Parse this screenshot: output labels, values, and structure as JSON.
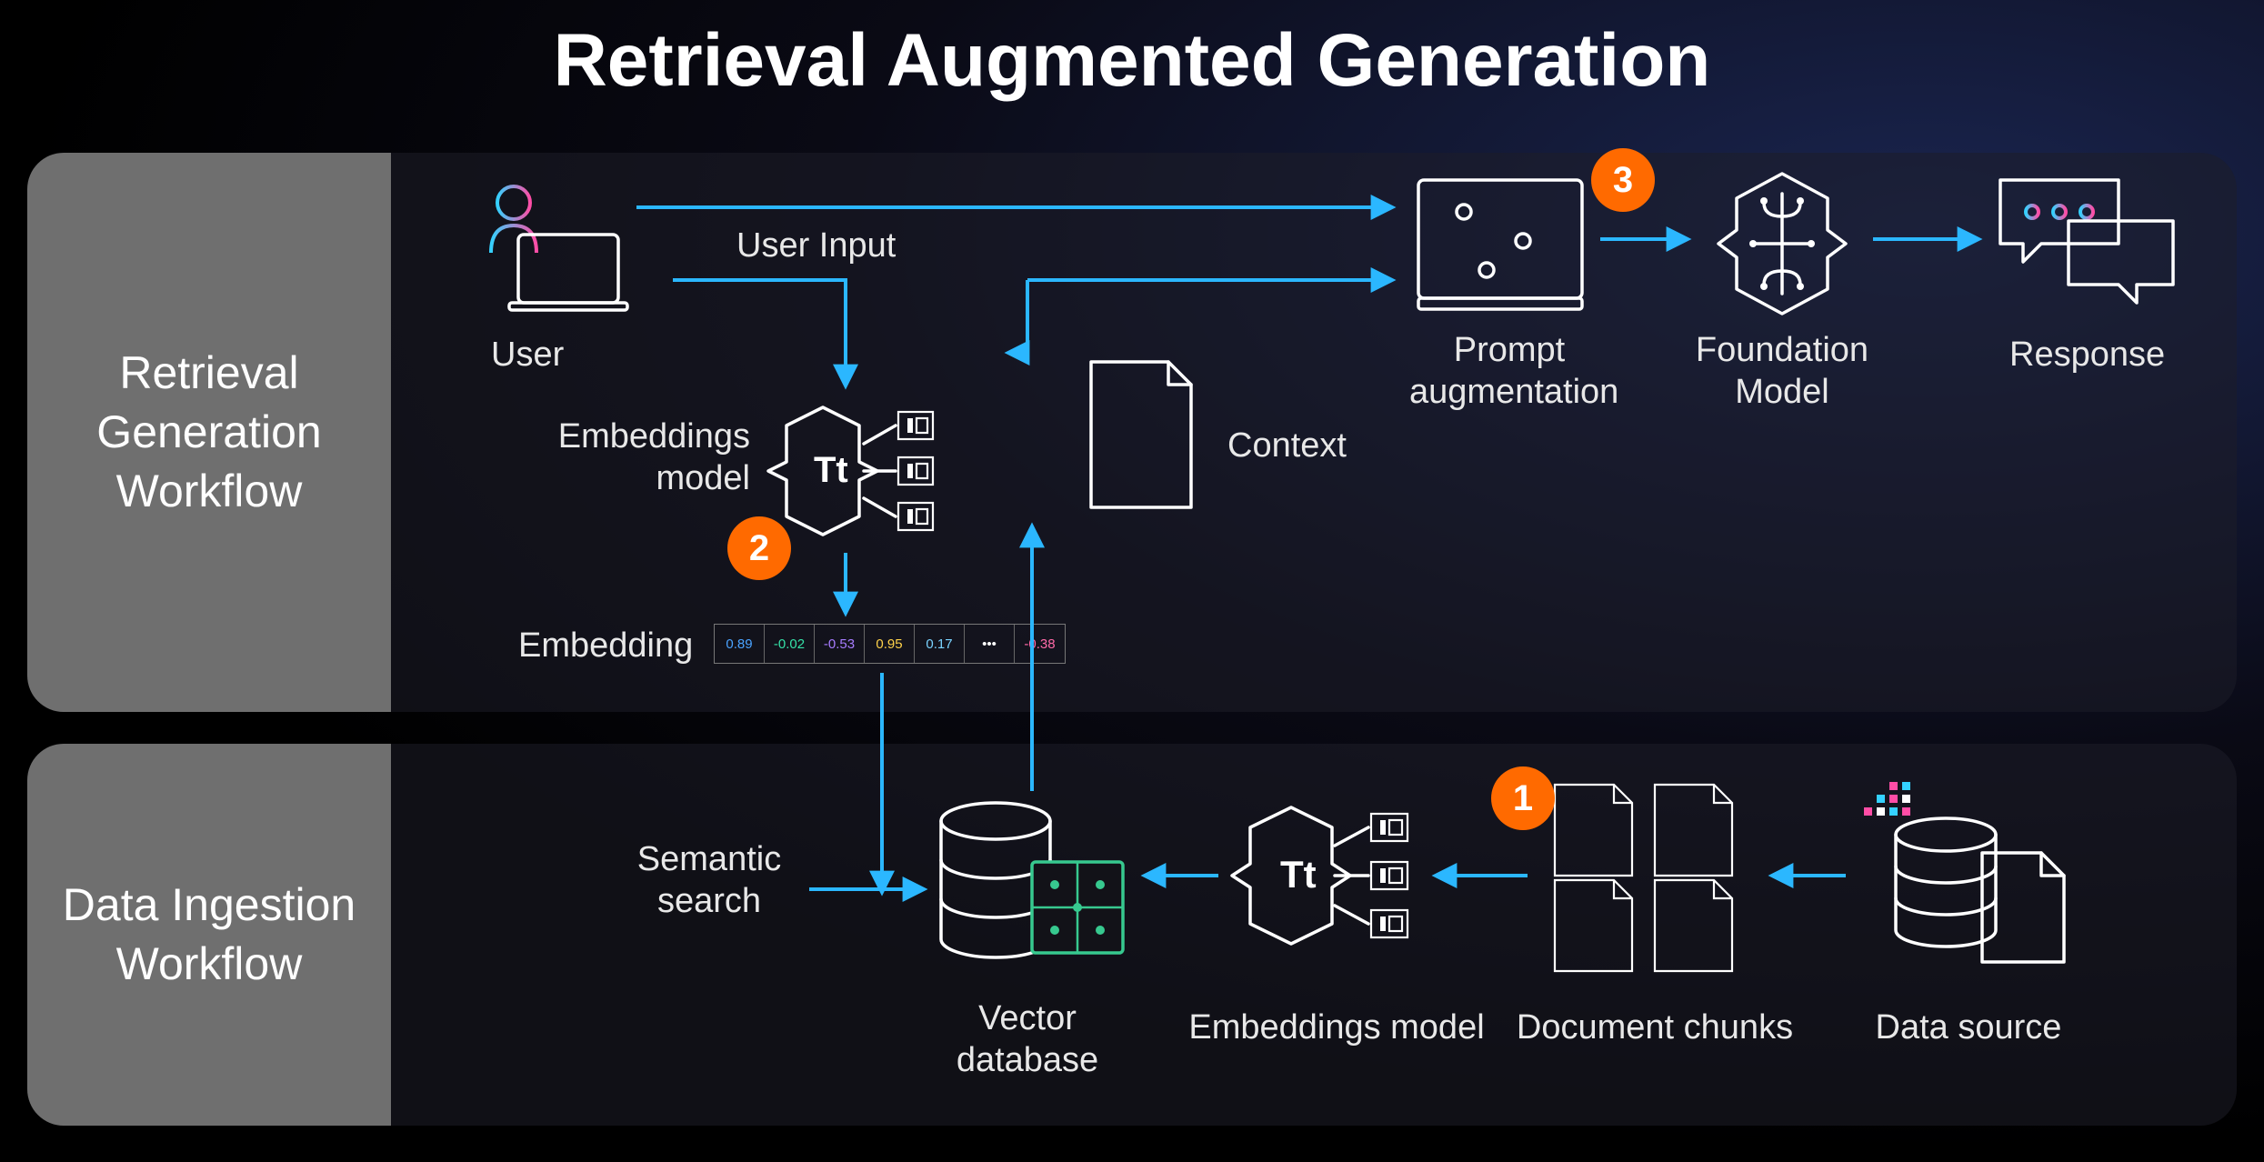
{
  "title": "Retrieval Augmented Generation",
  "panels": {
    "top": {
      "label": "Retrieval\nGeneration\nWorkflow"
    },
    "bottom": {
      "label": "Data Ingestion\nWorkflow"
    }
  },
  "nodes": {
    "user": "User",
    "user_input": "User Input",
    "embeddings_model_top": "Embeddings\nmodel",
    "embedding": "Embedding",
    "context": "Context",
    "prompt_aug": "Prompt\naugmentation",
    "foundation_model": "Foundation\nModel",
    "response": "Response",
    "semantic_search": "Semantic\nsearch",
    "vector_db": "Vector\ndatabase",
    "embeddings_model_bot": "Embeddings model",
    "doc_chunks": "Document chunks",
    "data_source": "Data source"
  },
  "embedding_vector": [
    "0.89",
    "-0.02",
    "-0.53",
    "0.95",
    "0.17",
    "•••",
    "-0.38"
  ],
  "steps": {
    "one": "1",
    "two": "2",
    "three": "3"
  },
  "colors": {
    "accent_orange": "#ff6a00",
    "arrow_blue": "#2bb7ff",
    "gradient_start": "#34d1ff",
    "gradient_end": "#ff4da6",
    "vector_db_accent": "#37c98f"
  }
}
